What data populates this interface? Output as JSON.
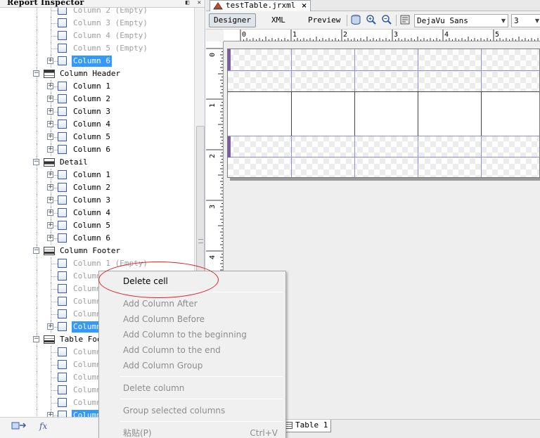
{
  "inspector": {
    "title": "Report Inspector",
    "title_buttons": "◧ ✕",
    "tree": [
      {
        "kind": "cell",
        "label": "Column 2 (Empty)",
        "muted": true,
        "selected": false,
        "partial": true
      },
      {
        "kind": "cell",
        "label": "Column 3 (Empty)",
        "muted": true,
        "selected": false
      },
      {
        "kind": "cell",
        "label": "Column 4 (Empty)",
        "muted": true,
        "selected": false
      },
      {
        "kind": "cell",
        "label": "Column 5 (Empty)",
        "muted": true,
        "selected": false
      },
      {
        "kind": "cell",
        "label": "Column 6",
        "muted": false,
        "selected": true,
        "expandable": true
      },
      {
        "kind": "section",
        "label": "Column Header",
        "band": "top"
      },
      {
        "kind": "cell",
        "label": "Column 1",
        "expandable": true
      },
      {
        "kind": "cell",
        "label": "Column 2",
        "expandable": true
      },
      {
        "kind": "cell",
        "label": "Column 3",
        "expandable": true
      },
      {
        "kind": "cell",
        "label": "Column 4",
        "expandable": true
      },
      {
        "kind": "cell",
        "label": "Column 5",
        "expandable": true
      },
      {
        "kind": "cell",
        "label": "Column 6",
        "expandable": true
      },
      {
        "kind": "section",
        "label": "Detail",
        "band": "mid"
      },
      {
        "kind": "cell",
        "label": "Column 1",
        "expandable": true
      },
      {
        "kind": "cell",
        "label": "Column 2",
        "expandable": true
      },
      {
        "kind": "cell",
        "label": "Column 3",
        "expandable": true
      },
      {
        "kind": "cell",
        "label": "Column 4",
        "expandable": true
      },
      {
        "kind": "cell",
        "label": "Column 5",
        "expandable": true
      },
      {
        "kind": "cell",
        "label": "Column 6",
        "expandable": true
      },
      {
        "kind": "section",
        "label": "Column Footer",
        "band": "bottom"
      },
      {
        "kind": "cell",
        "label": "Column 1 (Empty)",
        "muted": true
      },
      {
        "kind": "cell",
        "label": "Column 2",
        "muted": true
      },
      {
        "kind": "cell",
        "label": "Column 3",
        "muted": true
      },
      {
        "kind": "cell",
        "label": "Column 4",
        "muted": true
      },
      {
        "kind": "cell",
        "label": "Column 5",
        "muted": true
      },
      {
        "kind": "cell",
        "label": "Column 6",
        "selected": true,
        "expandable": true
      },
      {
        "kind": "section",
        "label": "Table Footer",
        "band": "bottom"
      },
      {
        "kind": "cell",
        "label": "Column 1",
        "muted": true
      },
      {
        "kind": "cell",
        "label": "Column 2",
        "muted": true
      },
      {
        "kind": "cell",
        "label": "Column 3",
        "muted": true
      },
      {
        "kind": "cell",
        "label": "Column 4",
        "muted": true
      },
      {
        "kind": "cell",
        "label": "Column 5",
        "muted": true
      },
      {
        "kind": "cell",
        "label": "Column 6",
        "selected": true,
        "expandable": true
      }
    ],
    "bottom_icons": [
      "report-icon",
      "fx-icon"
    ],
    "fx_label": "fx"
  },
  "editor": {
    "file_tab": "testTable.jrxml",
    "file_tab_close": "×",
    "toolbar": {
      "designer": "Designer",
      "xml": "XML",
      "preview": "Preview",
      "font": "DejaVu Sans",
      "size": "3"
    },
    "hruler": [
      "0",
      "1",
      "2",
      "3",
      "4",
      "5"
    ],
    "vruler": [
      "0",
      "1",
      "2",
      "3",
      "4"
    ],
    "bottom_tab": "Table 1"
  },
  "context_menu": {
    "items": [
      {
        "label": "Delete cell",
        "disabled": false
      },
      {
        "sep": true
      },
      {
        "label": "Add Column After",
        "disabled": true
      },
      {
        "label": "Add Column Before",
        "disabled": true
      },
      {
        "label": "Add Column to the beginning",
        "disabled": true
      },
      {
        "label": "Add Column to the end",
        "disabled": true
      },
      {
        "label": "Add Column Group",
        "disabled": true
      },
      {
        "sep": true
      },
      {
        "label": "Delete column",
        "disabled": true
      },
      {
        "sep": true
      },
      {
        "label": "Group selected columns",
        "disabled": true
      },
      {
        "sep": true
      },
      {
        "label": "粘贴(P)",
        "shortcut": "Ctrl+V",
        "disabled": true
      }
    ]
  },
  "colors": {
    "selection": "#3399ff",
    "annotation_ellipse": "#dd2222",
    "grid_line": "#9090d0"
  }
}
